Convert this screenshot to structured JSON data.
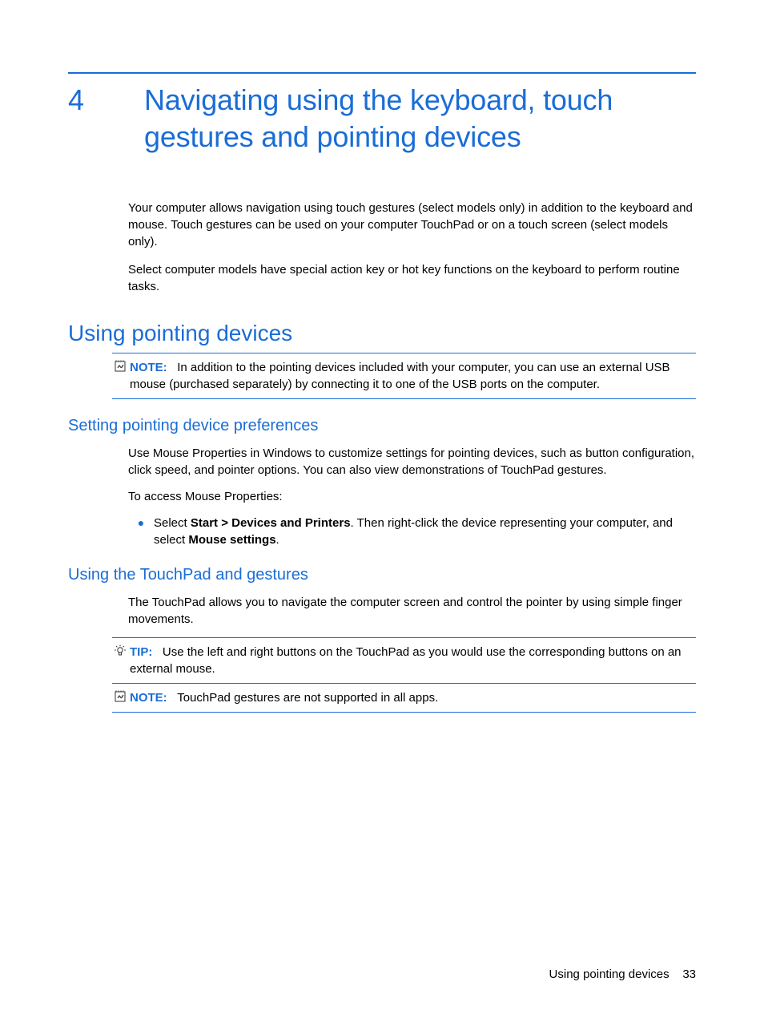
{
  "chapter": {
    "number": "4",
    "title": "Navigating using the keyboard, touch gestures and pointing devices"
  },
  "intro": {
    "p1": "Your computer allows navigation using touch gestures (select models only) in addition to the keyboard and mouse. Touch gestures can be used on your computer TouchPad or on a touch screen (select models only).",
    "p2": "Select computer models have special action key or hot key functions on the keyboard to perform routine tasks."
  },
  "sections": {
    "using_pointing_devices": {
      "title": "Using pointing devices",
      "note": {
        "label": "NOTE:",
        "text": "In addition to the pointing devices included with your computer, you can use an external USB mouse (purchased separately) by connecting it to one of the USB ports on the computer."
      },
      "setting_prefs": {
        "title": "Setting pointing device preferences",
        "p1": "Use Mouse Properties in Windows to customize settings for pointing devices, such as button configuration, click speed, and pointer options. You can also view demonstrations of TouchPad gestures.",
        "p2": "To access Mouse Properties:",
        "bullet": {
          "segs": {
            "s1": "Select ",
            "s2_bold": "Start > Devices and Printers",
            "s3": ". Then right-click the device representing your computer, and select ",
            "s4_bold": "Mouse settings",
            "s5": "."
          }
        }
      },
      "using_touchpad": {
        "title": "Using the TouchPad and gestures",
        "p1": "The TouchPad allows you to navigate the computer screen and control the pointer by using simple finger movements.",
        "tip": {
          "label": "TIP:",
          "text": "Use the left and right buttons on the TouchPad as you would use the corresponding buttons on an external mouse."
        },
        "note": {
          "label": "NOTE:",
          "text": "TouchPad gestures are not supported in all apps."
        }
      }
    }
  },
  "footer": {
    "section_name": "Using pointing devices",
    "page_number": "33"
  }
}
